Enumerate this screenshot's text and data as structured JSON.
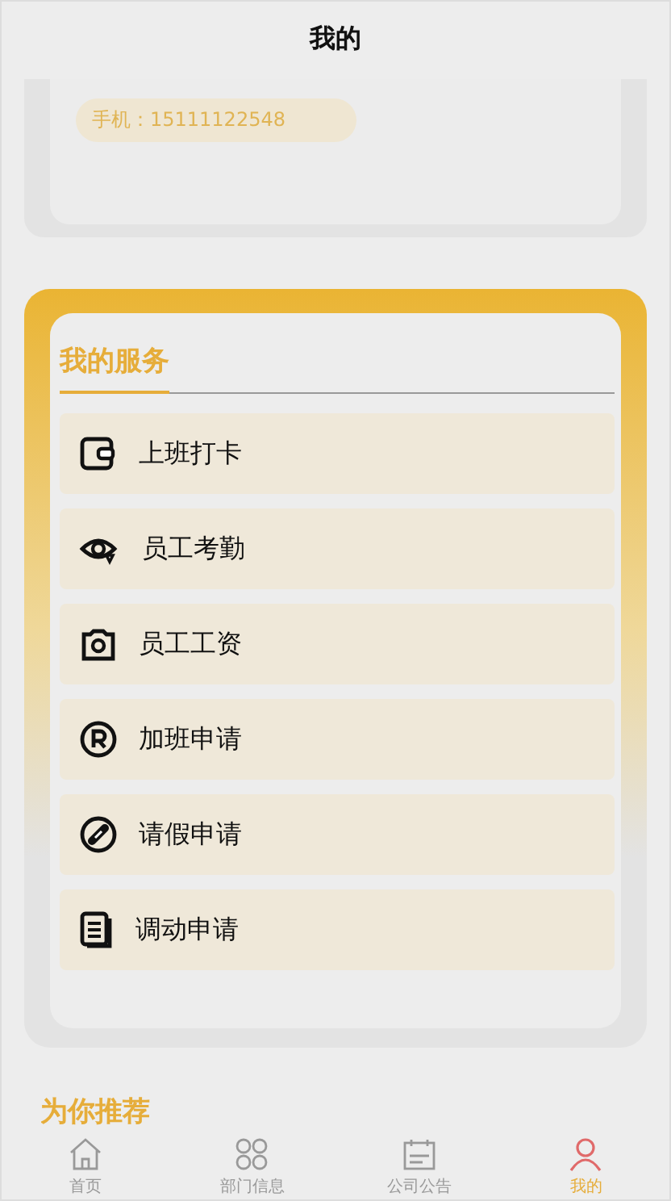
{
  "header": {
    "title": "我的"
  },
  "profile": {
    "phone": "手机：15111122548"
  },
  "services": {
    "title": "我的服务",
    "items": [
      {
        "label": "上班打卡"
      },
      {
        "label": "员工考勤"
      },
      {
        "label": "员工工资"
      },
      {
        "label": "加班申请"
      },
      {
        "label": "请假申请"
      },
      {
        "label": "调动申请"
      }
    ]
  },
  "recommend": {
    "title": "为你推荐"
  },
  "tab_bar": [
    {
      "label": "首页",
      "selected": false
    },
    {
      "label": "部门信息",
      "selected": false
    },
    {
      "label": "公司公告",
      "selected": false
    },
    {
      "label": "我的",
      "selected": true
    }
  ]
}
